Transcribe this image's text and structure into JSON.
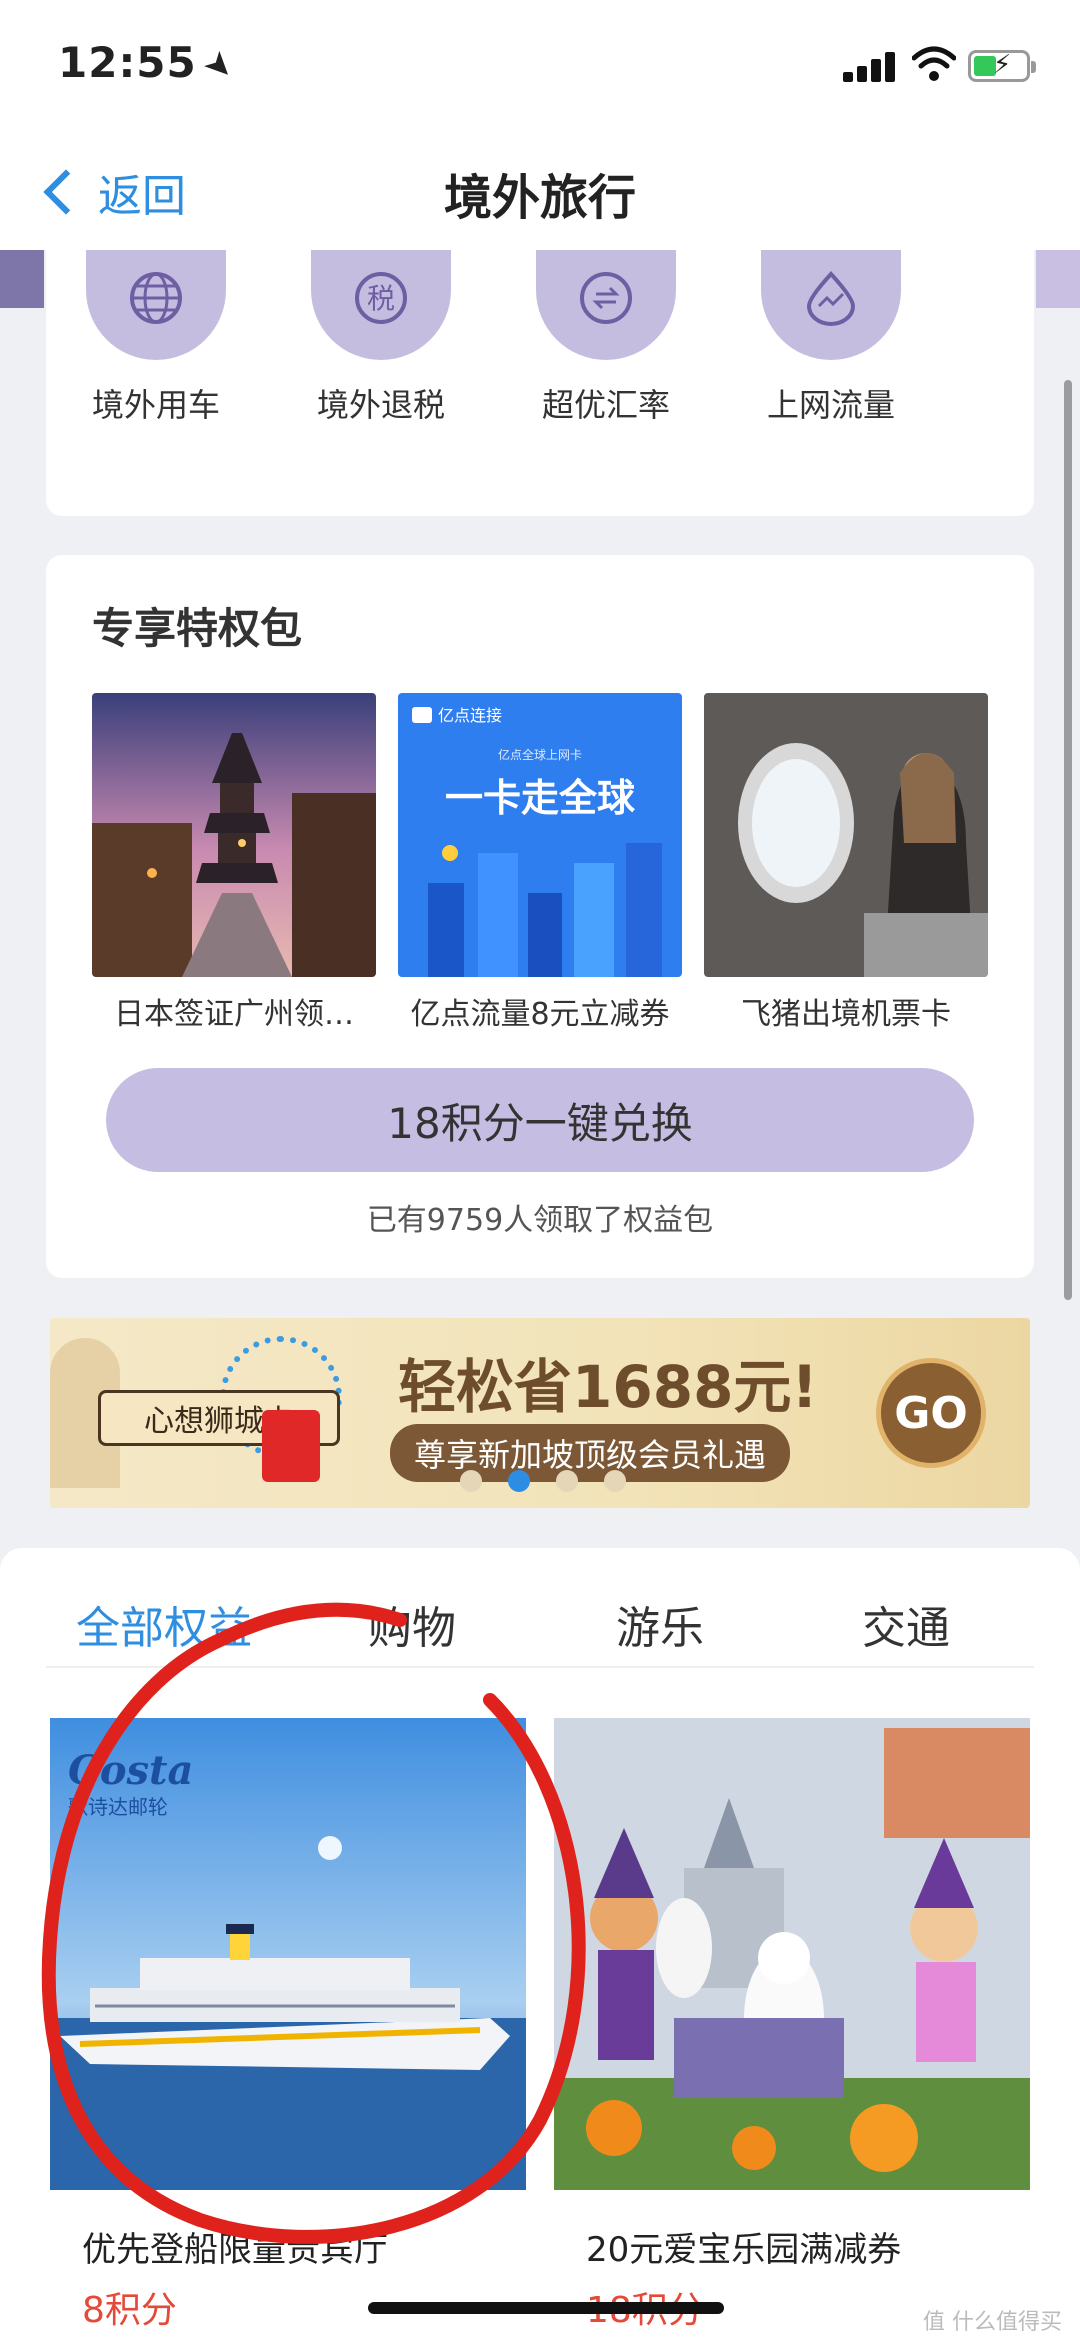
{
  "status_bar": {
    "time": "12:55"
  },
  "nav": {
    "back_label": "返回",
    "title": "境外旅行"
  },
  "quick_links": [
    {
      "label": "境外用车",
      "icon": "globe-icon"
    },
    {
      "label": "境外退税",
      "icon": "tax-refund-icon",
      "glyph": "税"
    },
    {
      "label": "超优汇率",
      "icon": "exchange-rate-icon"
    },
    {
      "label": "上网流量",
      "icon": "data-traffic-icon"
    }
  ],
  "privilege": {
    "title": "专享特权包",
    "items": [
      {
        "label": "日本签证广州领…"
      },
      {
        "label": "亿点流量8元立减券",
        "brand": "亿点连接",
        "small": "亿点全球上网卡",
        "headline": "一卡走全球"
      },
      {
        "label": "飞猪出境机票卡"
      }
    ],
    "redeem_button": "18积分一键兑换",
    "claimed_text": "已有9759人领取了权益包"
  },
  "banner": {
    "card_tag": "心想狮城卡",
    "title": "轻松省1688元!",
    "subtitle": "尊享新加坡顶级会员礼遇",
    "go_label": "GO",
    "active_dot": 1,
    "dot_count": 4
  },
  "benefits": {
    "tabs": [
      "全部权益",
      "购物",
      "游乐",
      "交通"
    ],
    "active_tab": 0,
    "products": [
      {
        "name": "优先登船限量贵宾厅",
        "points": "8积分",
        "brand": "Costa",
        "brand_sub": "歌诗达邮轮"
      },
      {
        "name": "20元爱宝乐园满减券",
        "points": "18积分"
      }
    ]
  },
  "watermark": "值 什么值得买",
  "colors": {
    "accent": "#2f8ee0",
    "purple": "#c6bee2",
    "points_red": "#e34a3a",
    "annotation_red": "#e0221c"
  }
}
